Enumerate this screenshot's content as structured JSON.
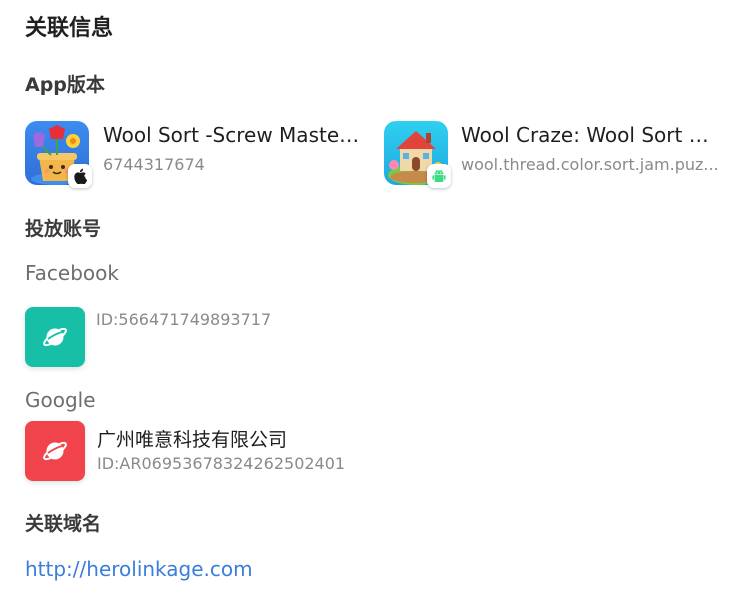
{
  "page": {
    "title": "关联信息"
  },
  "sections": {
    "app_versions": "App版本",
    "ad_accounts": "投放账号",
    "domains": "关联域名"
  },
  "apps": [
    {
      "name": "Wool Sort -Screw Master ...",
      "id": "6744317674",
      "platform_icon": "apple-icon"
    },
    {
      "name": "Wool Craze: Wool Sort Ga...",
      "id": "wool.thread.color.sort.jam.puz...",
      "platform_icon": "android-icon"
    }
  ],
  "accounts": {
    "facebook": {
      "label": "Facebook",
      "id": "ID:566471749893717",
      "icon_color": "#16bfa6",
      "icon": "planet-icon"
    },
    "google": {
      "label": "Google",
      "name": "广州唯意科技有限公司",
      "id": "ID:AR06953678324262502401",
      "icon_color": "#f0434c",
      "icon": "planet-icon"
    }
  },
  "domain": {
    "url": "http://herolinkage.com",
    "color": "#3b7ddd"
  }
}
